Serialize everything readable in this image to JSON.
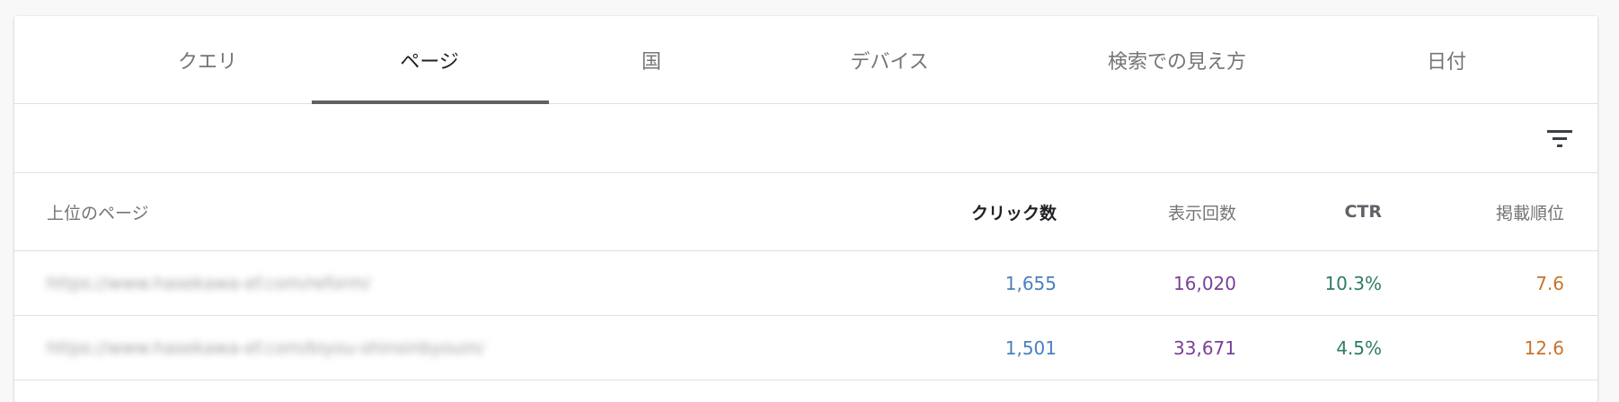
{
  "tabs": [
    {
      "label": "クエリ"
    },
    {
      "label": "ページ"
    },
    {
      "label": "国"
    },
    {
      "label": "デバイス"
    },
    {
      "label": "検索での見え方"
    },
    {
      "label": "日付"
    }
  ],
  "active_tab": "ページ",
  "filter_icon": "filter-icon",
  "table": {
    "headers": {
      "page": "上位のページ",
      "clicks": "クリック数",
      "impressions": "表示回数",
      "ctr": "CTR",
      "position": "掲載順位"
    },
    "rows": [
      {
        "url": "https://www.hasekawa-ef.com/reform/",
        "clicks": "1,655",
        "impressions": "16,020",
        "ctr": "10.3%",
        "position": "7.6"
      },
      {
        "url": "https://www.hasekawa-ef.com/biyou-shinsinbyouin/",
        "clicks": "1,501",
        "impressions": "33,671",
        "ctr": "4.5%",
        "position": "12.6"
      }
    ]
  },
  "colors": {
    "clicks": "#4a7fbf",
    "impressions": "#7b3f98",
    "ctr": "#2e7d60",
    "position": "#c7742c"
  }
}
